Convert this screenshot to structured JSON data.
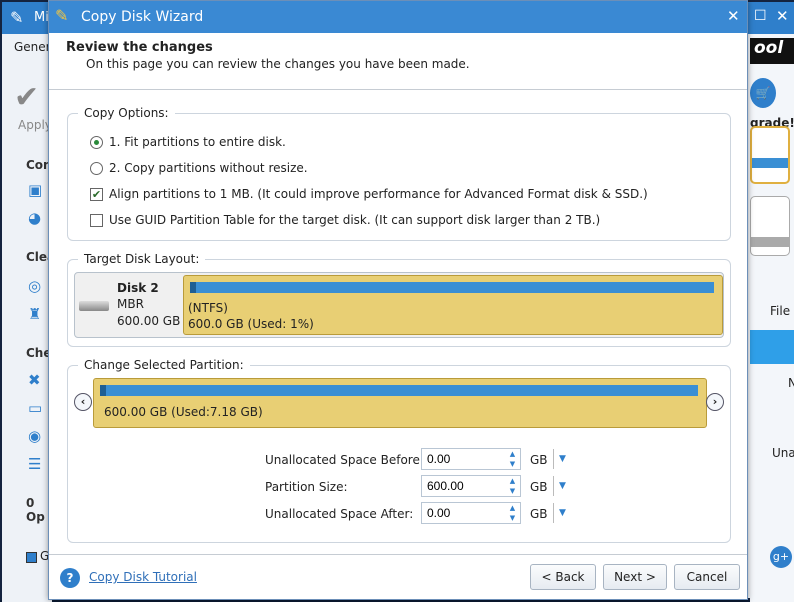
{
  "app": {
    "title": "Mi",
    "menu_tab": "Gener",
    "apply_label": "Apply",
    "brand_text": "ool",
    "upgrade_label": "grade!",
    "sidebar_headings": [
      "Con",
      "Clea",
      "Che"
    ],
    "ops_label": "0 Op",
    "legend_label": "G",
    "right_labels": [
      "File",
      "N",
      "Una"
    ]
  },
  "dialog": {
    "title": "Copy Disk Wizard",
    "heading": "Review the changes",
    "subheading": "On this page you can review the changes you have been made.",
    "copy_options": {
      "label": "Copy Options:",
      "options": [
        {
          "type": "radio",
          "label": "1. Fit partitions to entire disk.",
          "checked": true
        },
        {
          "type": "radio",
          "label": "2. Copy partitions without resize.",
          "checked": false
        },
        {
          "type": "checkbox",
          "label": "Align partitions to 1 MB.  (It could improve performance for Advanced Format disk & SSD.)",
          "checked": true
        },
        {
          "type": "checkbox",
          "label": "Use GUID Partition Table for the target disk. (It can support disk larger than 2 TB.)",
          "checked": false
        }
      ]
    },
    "target_layout": {
      "label": "Target Disk Layout:",
      "disk_name": "Disk 2",
      "disk_type": "MBR",
      "disk_size": "600.00 GB",
      "partition_fs": "(NTFS)",
      "partition_info": "600.0 GB (Used: 1%)",
      "used_percent": 1
    },
    "change_partition": {
      "label": "Change Selected Partition:",
      "partition_info": "600.00 GB (Used:7.18 GB)",
      "fields": [
        {
          "label": "Unallocated Space Before:",
          "value": "0.00",
          "unit": "GB"
        },
        {
          "label": "Partition Size:",
          "value": "600.00",
          "unit": "GB"
        },
        {
          "label": "Unallocated Space After:",
          "value": "0.00",
          "unit": "GB"
        }
      ]
    },
    "footer": {
      "tutorial_link": "Copy Disk Tutorial",
      "back": "< Back",
      "next": "Next >",
      "cancel": "Cancel"
    }
  },
  "colors": {
    "title_bar": "#3a89d3",
    "partition": "#e8cf74",
    "usage_bar": "#3a8fd4"
  }
}
